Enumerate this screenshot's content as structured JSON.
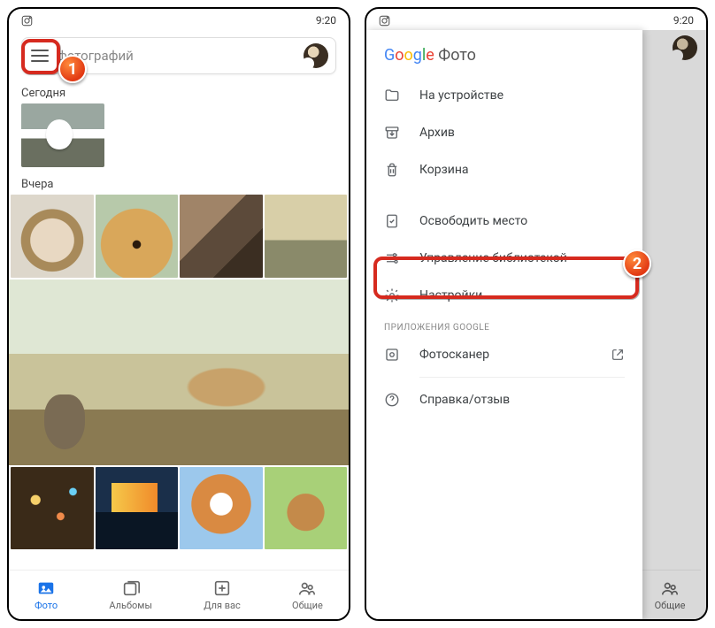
{
  "status": {
    "time": "9:20"
  },
  "search": {
    "placeholder": "фотографий"
  },
  "sections": {
    "today": "Сегодня",
    "yesterday": "Вчера"
  },
  "nav": {
    "photos": "Фото",
    "albums": "Альбомы",
    "for_you": "Для вас",
    "sharing": "Общие"
  },
  "drawer": {
    "brand_suffix": " Фото",
    "items": {
      "on_device": "На устройстве",
      "archive": "Архив",
      "trash": "Корзина",
      "free_up": "Освободить место",
      "manage_library": "Управление библиотекой",
      "settings": "Настройки"
    },
    "section_apps": "ПРИЛОЖЕНИЯ GOOGLE",
    "photoscan": "Фотосканер",
    "help": "Справка/отзыв"
  },
  "annotations": {
    "step1": "1",
    "step2": "2"
  }
}
